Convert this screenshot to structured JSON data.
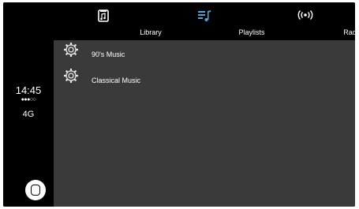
{
  "status": {
    "time": "14:45",
    "signal": "●●●○○",
    "network": "4G"
  },
  "tabs": [
    {
      "label": "Library",
      "icon": "library-icon"
    },
    {
      "label": "Playlists",
      "icon": "playlists-icon",
      "active": true
    },
    {
      "label": "Radio",
      "icon": "radio-icon"
    }
  ],
  "playlists": [
    {
      "title": "90's Music",
      "icon": "gear-icon"
    },
    {
      "title": "Classical Music",
      "icon": "gear-icon"
    }
  ],
  "colors": {
    "active_tab": "#4fa3e0",
    "list_background": "#3a3a3a",
    "chrome": "#000000"
  }
}
